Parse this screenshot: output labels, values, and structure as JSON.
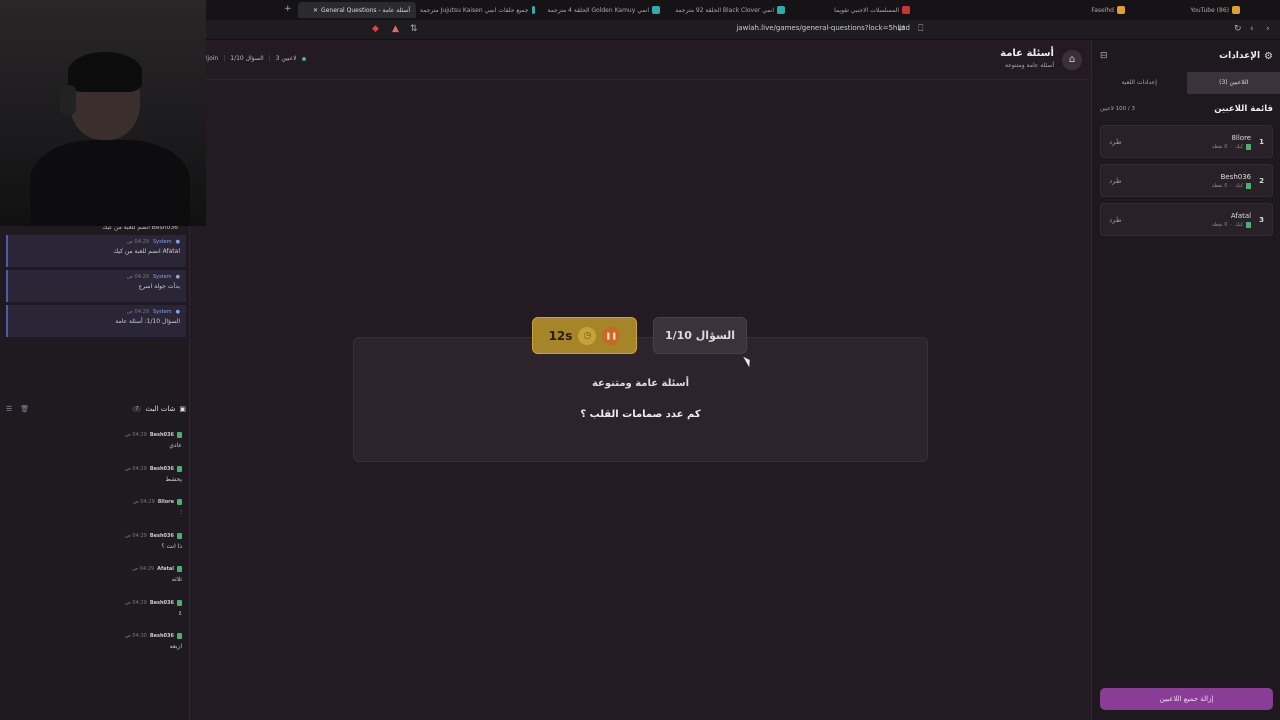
{
  "browser": {
    "tabs": [
      {
        "label": "(86) YouTube"
      },
      {
        "label": "Faselhd"
      },
      {
        "label": "المسلسلات الاجنبي تقويما"
      },
      {
        "label": "انمي Black Clover الحلقة 92 مترجمة"
      },
      {
        "label": "انمي Golden Kamuy الحلقة 4 مترجمة"
      },
      {
        "label": "جميع حلقات انمي Jujutsu Kaisen مترجمة"
      },
      {
        "label": "أسئلة عامة - General Questions"
      }
    ],
    "url": "jawlah.live/games/general-questions?lock=5hliad"
  },
  "system_messages": [
    {
      "name": "System",
      "time": "04:29 ص",
      "text": "Afatal انضم للعبة من كيك"
    },
    {
      "name": "System",
      "time": "04:29 ص",
      "text": "بدأت جولة اسرع"
    },
    {
      "name": "System",
      "time": "04:29 ص",
      "text": "السؤال 1/10: أسئلة عامة"
    }
  ],
  "partial_msg": "Besh036 انضم للعبة من كيك",
  "chat": {
    "title": "شات البث",
    "count": "7",
    "messages": [
      {
        "name": "Besh036",
        "time": "04:29 ص",
        "text": "عادي"
      },
      {
        "name": "Besh036",
        "time": "04:29 ص",
        "text": "يحشط"
      },
      {
        "name": "8llore",
        "time": "04:29 ص",
        "text": "؛"
      },
      {
        "name": "Besh036",
        "time": "04:29 ص",
        "text": "ذا انت ؟"
      },
      {
        "name": "Afatal",
        "time": "04:29 ص",
        "text": "ثلاثه"
      },
      {
        "name": "Besh036",
        "time": "04:29 ص",
        "text": "٤"
      },
      {
        "name": "Besh036",
        "time": "04:30 ص",
        "text": "اربعه"
      }
    ]
  },
  "game": {
    "title": "أسئلة عامة",
    "subtitle": "أسئلة عامة ومتنوعة",
    "status_players": "3 لاعبين",
    "status_question": "السؤال 1/10",
    "status_join": "!join",
    "question_number": "السؤال 1/10",
    "timer": "12s",
    "category": "أسئلة عامة ومتنوعة",
    "question": "كم عدد صمامات القلب ؟"
  },
  "settings": {
    "title": "الإعدادات",
    "tab_players": "اللاعبين (3)",
    "tab_game": "إعدادات اللعبة",
    "list_title": "قائمة اللاعبين",
    "list_count": "3 / 100 لاعبين",
    "kick_label": "طرد",
    "players": [
      {
        "rank": "1",
        "name": "8llore",
        "platform": "كيك",
        "points": "0 نقطة"
      },
      {
        "rank": "2",
        "name": "Besh036",
        "platform": "كيك",
        "points": "0 نقطة"
      },
      {
        "rank": "3",
        "name": "Afatal",
        "platform": "كيك",
        "points": "0 نقطة"
      }
    ],
    "remove_all": "إزالة جميع اللاعبين"
  }
}
